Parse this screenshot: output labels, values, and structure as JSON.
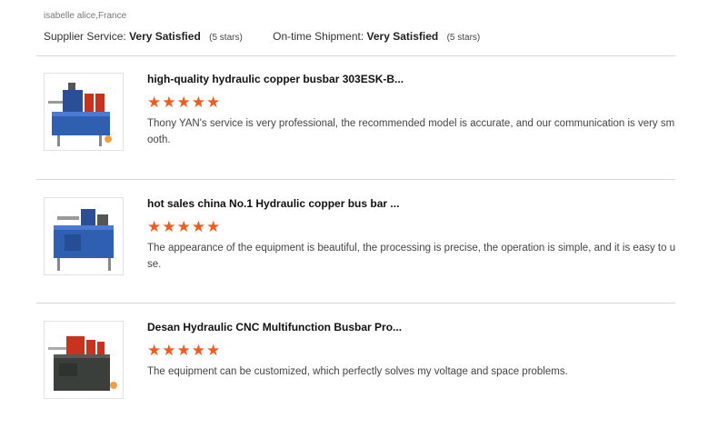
{
  "reviewer": {
    "name": "isabelle alice,France"
  },
  "ratings": {
    "supplier_service": {
      "label": "Supplier Service:",
      "value": "Very Satisfied",
      "note": "(5 stars)"
    },
    "on_time_shipment": {
      "label": "On-time Shipment:",
      "value": "Very Satisfied",
      "note": "(5 stars)"
    }
  },
  "reviews": [
    {
      "title": "high-quality hydraulic copper busbar 303ESK-B...",
      "stars": "★★★★★",
      "rating": 5,
      "comment": "Thony YAN's service is very professional, the recommended model is accurate, and our communication is very smooth."
    },
    {
      "title": "hot sales china No.1 Hydraulic copper bus bar ...",
      "stars": "★★★★★",
      "rating": 5,
      "comment": "The appearance of the equipment is beautiful, the processing is precise, the operation is simple, and it is easy to use."
    },
    {
      "title": "Desan Hydraulic CNC Multifunction Busbar Pro...",
      "stars": "★★★★★",
      "rating": 5,
      "comment": "The equipment can be customized, which perfectly solves my voltage and space problems."
    }
  ],
  "colors": {
    "star": "#f25a1e",
    "machine_blue": "#2f5fb0",
    "machine_red": "#c8321e",
    "machine_dark": "#3a3f3c"
  }
}
